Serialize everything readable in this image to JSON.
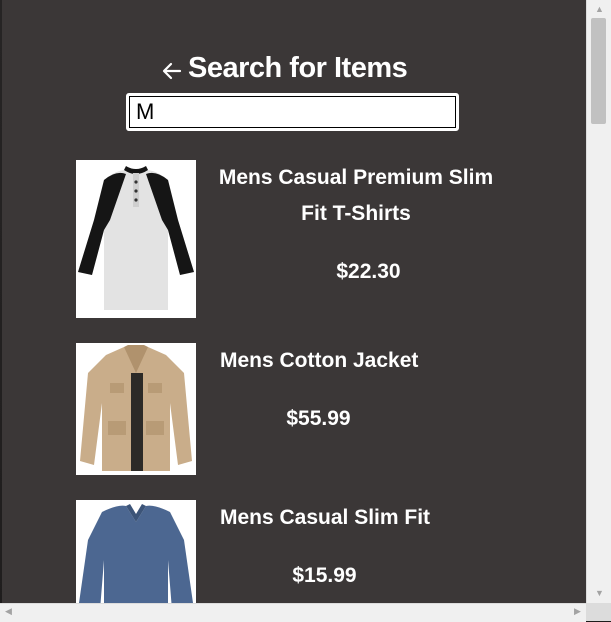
{
  "header": {
    "back_icon": "arrow-left-icon",
    "title": "Search for Items"
  },
  "search": {
    "value": "M",
    "placeholder": ""
  },
  "items": [
    {
      "name_line1": "Mens Casual Premium Slim",
      "name_line2": "Fit T-Shirts",
      "price": "$22.30",
      "image": "raglan-tshirt-image"
    },
    {
      "name_line1": "Mens Cotton Jacket",
      "name_line2": "",
      "price": "$55.99",
      "image": "cotton-jacket-image"
    },
    {
      "name_line1": "Mens Casual Slim Fit",
      "name_line2": "",
      "price": "$15.99",
      "image": "slim-fit-shirt-image"
    }
  ],
  "scrollbars": {
    "up_arrow": "▲",
    "down_arrow": "▼",
    "left_arrow": "◀",
    "right_arrow": "▶"
  },
  "colors": {
    "modal_bg": "#3b3737",
    "text": "#ffffff"
  }
}
